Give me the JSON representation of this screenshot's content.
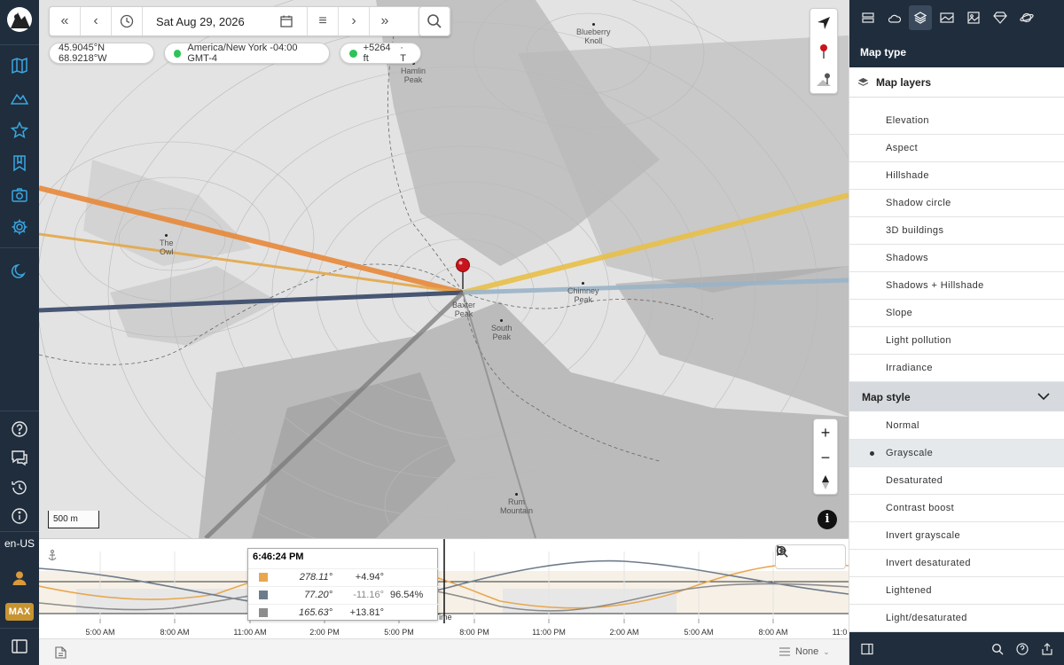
{
  "sidebar": {
    "language": "en-US",
    "plan_badge": "MAX",
    "icons": [
      "map-icon",
      "mountain-icon",
      "star-icon",
      "bookmark-icon",
      "camera-icon",
      "gear-icon",
      "moon-icon",
      "help-icon",
      "chat-icon",
      "history-icon",
      "info-icon",
      "user-icon",
      "panel-toggle-icon"
    ]
  },
  "toolbar": {
    "date": "Sat Aug 29, 2026"
  },
  "status": {
    "coordinates": "45.9045°N 68.9218°W",
    "timezone": "America/New York -04:00 GMT-4",
    "elevation": "+5264 ft",
    "elevation_suffix": "· T"
  },
  "map": {
    "scale_label": "500 m",
    "places": {
      "blueberry": [
        "Blueberry",
        "Knoll"
      ],
      "hamlin": [
        "Hamlin",
        "Peak"
      ],
      "owl": [
        "The",
        "Owl"
      ],
      "baxter": [
        "Baxter",
        "Peak"
      ],
      "chimney": [
        "Chimney",
        "Peak"
      ],
      "south": [
        "South",
        "Peak"
      ],
      "rum": [
        "Rum",
        "Mountain"
      ]
    },
    "accent_colors": {
      "sunrise_line": "#e8893a",
      "sun_line": "#e3a84a",
      "sunset_line": "#e8c04a",
      "moon_line": "#3f4f6e",
      "moon_set_line": "#9ab4c8",
      "shadow_line": "#7a7a7a",
      "pin": "#c8141c"
    }
  },
  "timeline": {
    "time_labels": [
      "5:00 AM",
      "8:00 AM",
      "11:00 AM",
      "2:00 PM",
      "5:00 PM",
      "8:00 PM",
      "11:00 PM",
      "2:00 AM",
      "5:00 AM",
      "8:00 AM",
      "11:0"
    ],
    "cursor_label": "Time",
    "tooltip": {
      "time": "6:46:24 PM",
      "rows": [
        {
          "color": "#e8a74f",
          "azimuth": "278.11°",
          "elevation": "+4.94°",
          "illumination": ""
        },
        {
          "color": "#6d7c8c",
          "azimuth": "77.20°",
          "elevation": "-11.16°",
          "illumination": "96.54%"
        },
        {
          "color": "#8d8d8d",
          "azimuth": "165.63°",
          "elevation": "+13.81°",
          "illumination": ""
        }
      ]
    }
  },
  "bottom_bar": {
    "selector_value": "None"
  },
  "right_panel": {
    "title": "Map type",
    "layers_title": "Map layers",
    "layers": [
      "Elevation",
      "Aspect",
      "Hillshade",
      "Shadow circle",
      "3D buildings",
      "Shadows",
      "Shadows + Hillshade",
      "Slope",
      "Light pollution",
      "Irradiance"
    ],
    "style_title": "Map style",
    "styles": [
      "Normal",
      "Grayscale",
      "Desaturated",
      "Contrast boost",
      "Invert grayscale",
      "Invert desaturated",
      "Lightened",
      "Light/desaturated"
    ],
    "selected_style": "Grayscale"
  }
}
